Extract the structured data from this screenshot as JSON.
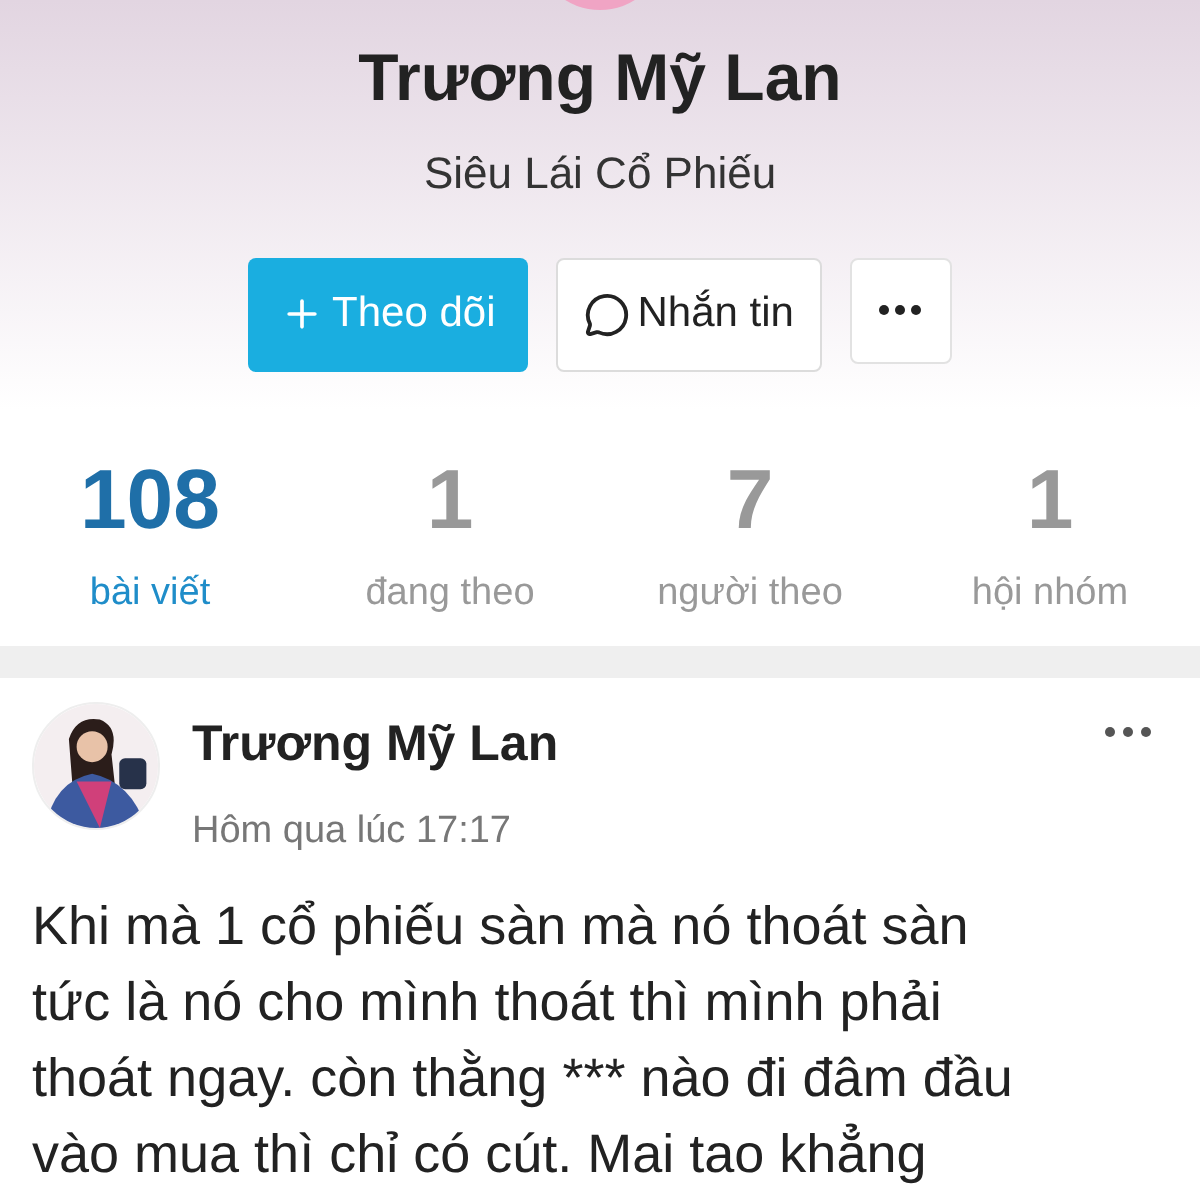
{
  "profile": {
    "name": "Trương Mỹ Lan",
    "subtitle": "Siêu Lái Cổ Phiếu",
    "actions": [
      {
        "kind": "follow",
        "label": "Theo dõi"
      },
      {
        "kind": "message",
        "label": "Nhắn tin"
      },
      {
        "kind": "more"
      }
    ]
  },
  "stats": [
    {
      "value": "108",
      "label": "bài viết",
      "selected": true
    },
    {
      "value": "1",
      "label": "đang theo",
      "selected": false
    },
    {
      "value": "7",
      "label": "người theo",
      "selected": false
    },
    {
      "value": "1",
      "label": "hội nhóm",
      "selected": false
    }
  ],
  "post": {
    "author": "Trương Mỹ Lan",
    "time": "Hôm qua lúc 17:17",
    "lines": [
      "Khi mà 1 cổ phiếu sàn mà nó thoát sàn",
      "tức là nó cho mình thoát thì mình phải",
      "thoát ngay. còn thằng *** nào đi đâm đầu",
      "vào mua thì chỉ có cút. Mai tao khẳng"
    ]
  }
}
